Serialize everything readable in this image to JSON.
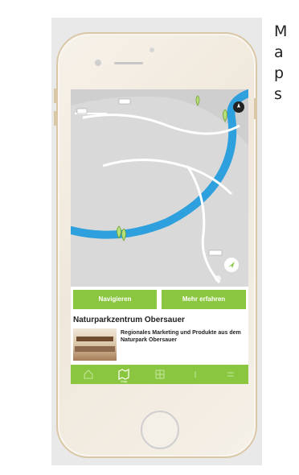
{
  "side_label": [
    "M",
    "a",
    "p",
    "s"
  ],
  "actions": {
    "route_label": "Navigieren",
    "more_label": "Mehr erfahren"
  },
  "poi": {
    "title": "Naturparkzentrum Obersauer",
    "description": "Regionales Marketing und Produkte aus dem Naturpark Obersauer"
  },
  "tabbar": {
    "active_label": "Map"
  },
  "colors": {
    "accent": "#8ac63f",
    "water": "#2da0dd"
  }
}
